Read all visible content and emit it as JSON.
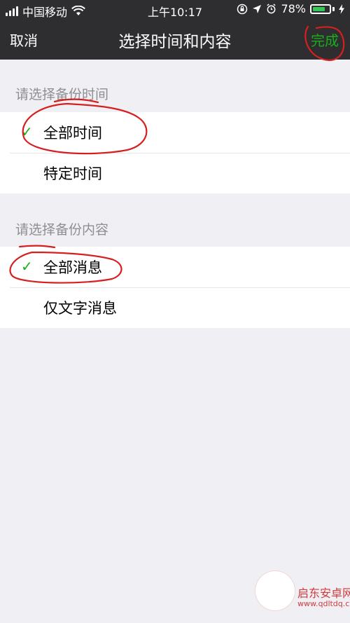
{
  "status_bar": {
    "carrier": "中国移动",
    "time": "上午10:17",
    "battery_percent": "78%",
    "battery_level": 0.78
  },
  "nav": {
    "cancel_label": "取消",
    "title": "选择时间和内容",
    "done_label": "完成"
  },
  "time_section": {
    "header": "请选择备份时间",
    "options": [
      {
        "label": "全部时间",
        "selected": true
      },
      {
        "label": "特定时间",
        "selected": false
      }
    ]
  },
  "content_section": {
    "header": "请选择备份内容",
    "options": [
      {
        "label": "全部消息",
        "selected": true
      },
      {
        "label": "仅文字消息",
        "selected": false
      }
    ]
  },
  "check_glyph": "✓",
  "watermark": {
    "text": "启东安卓网",
    "url": "www.qdltdq.com"
  },
  "colors": {
    "accent": "#1aad19",
    "nav_background": "#2e2e30",
    "page_background": "#efeff4",
    "annotation_red": "#d62020"
  }
}
